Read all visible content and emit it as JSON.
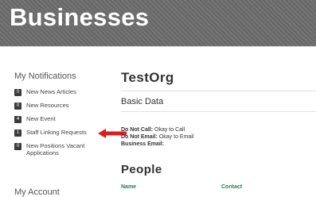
{
  "header": {
    "title": "Businesses"
  },
  "sidebar": {
    "heading": "My Notifications",
    "items": [
      {
        "count": "0",
        "label": "New News Articles"
      },
      {
        "count": "0",
        "label": "New Resources"
      },
      {
        "count": "4",
        "label": "New Event"
      },
      {
        "count": "1",
        "label": "Staff Linking Requests"
      },
      {
        "count": "0",
        "label": "New Positions Vacant Applications"
      }
    ],
    "second_heading": "My Account"
  },
  "main": {
    "org_name": "TestOrg",
    "section_label": "Basic Data",
    "fields": [
      {
        "key": "Do Not Call:",
        "value": " Okay to Call"
      },
      {
        "key": "Do Not Email:",
        "value": " Okay to Email"
      },
      {
        "key": "Business Email:",
        "value": ""
      }
    ],
    "people_heading": "People",
    "people_columns": [
      "Name",
      "Contact"
    ]
  },
  "colors": {
    "banner": "#6d6d6d",
    "arrow": "#e01b1b",
    "badge": "#3b3b3b",
    "table_header": "#2a7a55"
  },
  "icons": {
    "pointer": "red-arrow-icon"
  }
}
